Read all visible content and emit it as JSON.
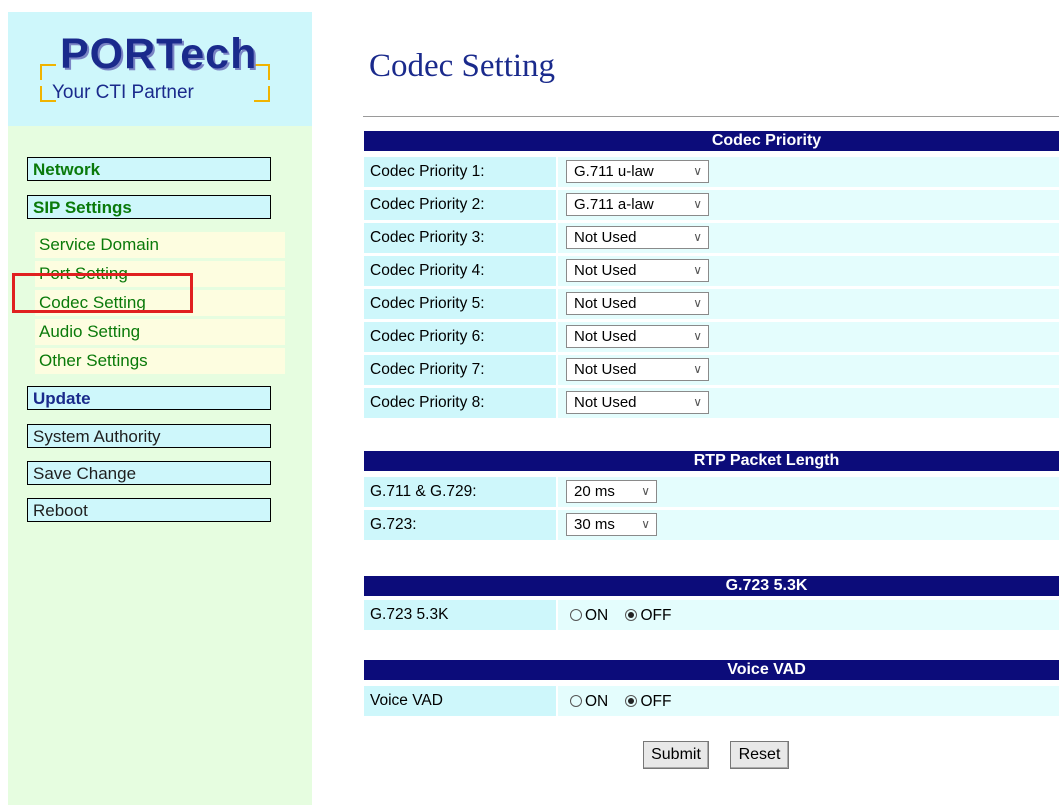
{
  "logo": {
    "brand": "PORTech",
    "tagline": "Your CTI Partner"
  },
  "sidebar": {
    "network": "Network",
    "sip_settings": "SIP Settings",
    "sub_items": [
      "Service Domain",
      "Port Setting",
      "Codec Setting",
      "Audio Setting",
      "Other Settings"
    ],
    "update": "Update",
    "system_authority": "System Authority",
    "save_change": "Save Change",
    "reboot": "Reboot"
  },
  "page": {
    "title": "Codec Setting"
  },
  "codec_priority": {
    "header": "Codec Priority",
    "rows": [
      {
        "label": "Codec Priority 1:",
        "value": "G.711 u-law"
      },
      {
        "label": "Codec Priority 2:",
        "value": "G.711 a-law"
      },
      {
        "label": "Codec Priority 3:",
        "value": "Not Used"
      },
      {
        "label": "Codec Priority 4:",
        "value": "Not Used"
      },
      {
        "label": "Codec Priority 5:",
        "value": "Not Used"
      },
      {
        "label": "Codec Priority 6:",
        "value": "Not Used"
      },
      {
        "label": "Codec Priority 7:",
        "value": "Not Used"
      },
      {
        "label": "Codec Priority 8:",
        "value": "Not Used"
      }
    ]
  },
  "rtp": {
    "header": "RTP Packet Length",
    "rows": [
      {
        "label": "G.711 & G.729:",
        "value": "20 ms"
      },
      {
        "label": "G.723:",
        "value": "30 ms"
      }
    ]
  },
  "g723_53k": {
    "header": "G.723 5.3K",
    "label": "G.723 5.3K",
    "on": "ON",
    "off": "OFF",
    "selected": "OFF"
  },
  "voice_vad": {
    "header": "Voice VAD",
    "label": "Voice VAD",
    "on": "ON",
    "off": "OFF",
    "selected": "OFF"
  },
  "buttons": {
    "submit": "Submit",
    "reset": "Reset"
  },
  "colors": {
    "header_bg": "#0c0c7a",
    "title": "#1a2a8c",
    "nav_green": "#0a7a0a",
    "highlight": "#e02020"
  },
  "icons": {
    "select_arrow": "chevron-down-icon"
  }
}
